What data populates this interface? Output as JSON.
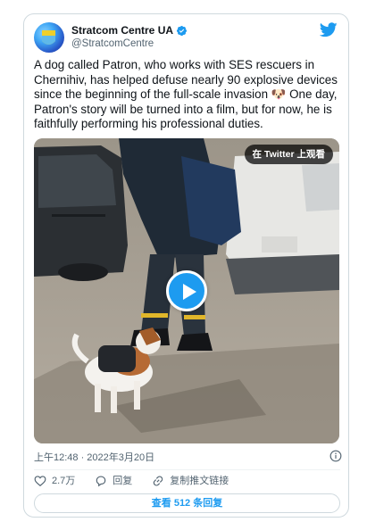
{
  "account": {
    "display_name": "Stratcom Centre UA",
    "handle": "@StratcomCentre",
    "verified": true
  },
  "tweet": {
    "text": "A dog called Patron, who works with SES rescuers in Chernihiv, has helped defuse nearly 90 explosive devices since the beginning of the full-scale invasion 🐶 One day, Patron's story will be turned into a film, but for now, he is faithfully performing his professional duties."
  },
  "media": {
    "view_on_twitter_label": "在 Twitter 上观看",
    "play_icon": "play-icon"
  },
  "meta": {
    "timestamp": "上午12:48 · 2022年3月20日",
    "info_icon": "info-icon"
  },
  "actions": {
    "like_count": "2.7万",
    "reply_label": "回复",
    "copy_link_label": "复制推文链接"
  },
  "replies_button_label": "查看 512 条回复",
  "colors": {
    "accent": "#1d9bf0",
    "like_red": "#f91880",
    "secondary_text": "#536471",
    "border": "#cfd9de"
  }
}
